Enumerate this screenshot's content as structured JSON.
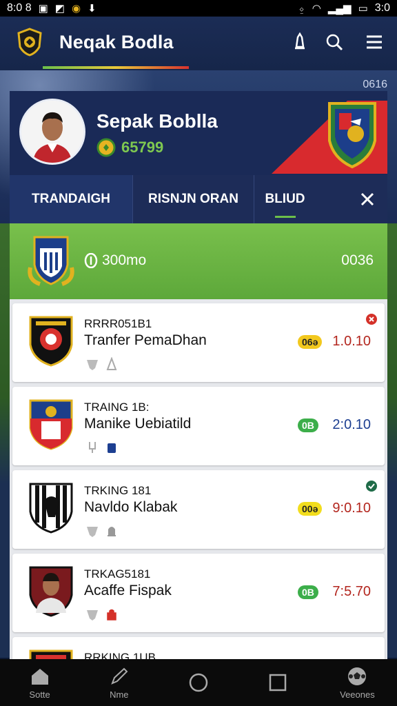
{
  "status_bar": {
    "time": "8:0 8",
    "right_time": "3:0"
  },
  "header": {
    "title": "Nɘpak Bodla",
    "title_text": "Neqak Bodla"
  },
  "hero": {
    "corner_text": "0616",
    "player_name": "Sepak Boblla",
    "coins": "65799"
  },
  "tabs": [
    {
      "label": "TRANDAIGH"
    },
    {
      "label": "RISNJN ORAN"
    },
    {
      "label": "BLIUD"
    }
  ],
  "banner": {
    "amount": "300mo",
    "right_value": "0036"
  },
  "list": [
    {
      "code": "RRRR051B1",
      "name": "Tranfer PemaDhan",
      "pill": "06ə",
      "pill_color": "#f2c81e",
      "value": "1.0.10",
      "value_color": "#b3261e",
      "badge": "close",
      "badge_color": "#d43129"
    },
    {
      "code": "TRAING 1B:",
      "name": "Manike Uebiatild",
      "pill": "0B",
      "pill_color": "#3cae4a",
      "value": "2:0.10",
      "value_color": "#1d3f91",
      "badge": "",
      "badge_color": ""
    },
    {
      "code": "TRKING 181",
      "name": "Navldo Klabak",
      "pill": "00ə",
      "pill_color": "#f2dd1e",
      "value": "9:0.10",
      "value_color": "#b3261e",
      "badge": "check",
      "badge_color": "#1f6b48"
    },
    {
      "code": "TRKAG5181",
      "name": "Acaffe Fispak",
      "pill": "0B",
      "pill_color": "#3cae4a",
      "value": "7:5.70",
      "value_color": "#b3261e",
      "badge": "",
      "badge_color": ""
    },
    {
      "code": "RRKING 1UB",
      "name": "",
      "pill": "",
      "pill_color": "",
      "value": "",
      "value_color": "",
      "badge": "",
      "badge_color": ""
    }
  ],
  "nav": [
    {
      "label": "Sotte",
      "icon": "home-icon"
    },
    {
      "label": "Nme",
      "icon": "pencil-icon"
    },
    {
      "label": "",
      "icon": "circle-icon"
    },
    {
      "label": "",
      "icon": "square-icon"
    },
    {
      "label": "Veeones",
      "icon": "soccer-ball-icon"
    }
  ]
}
